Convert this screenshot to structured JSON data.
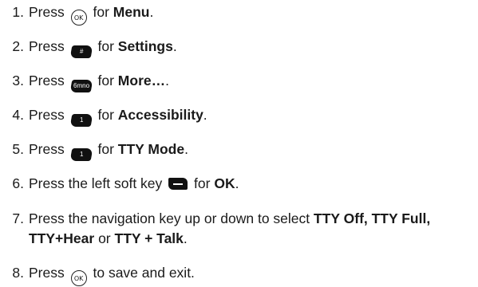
{
  "steps": [
    {
      "num": "1.",
      "pre": "Press",
      "key": "ok",
      "key_label": "OK",
      "mid": "for",
      "bold": "Menu",
      "post": "."
    },
    {
      "num": "2.",
      "pre": "Press",
      "key": "hash",
      "key_label": "#",
      "mid": "for",
      "bold": "Settings",
      "post": "."
    },
    {
      "num": "3.",
      "pre": "Press",
      "key": "six",
      "key_label": "6mno",
      "mid": "for",
      "bold": "More…",
      "post": "."
    },
    {
      "num": "4.",
      "pre": "Press",
      "key": "one",
      "key_label": "1",
      "mid": "for",
      "bold": "Accessibility",
      "post": "."
    },
    {
      "num": "5.",
      "pre": "Press",
      "key": "one",
      "key_label": "1",
      "mid": "for",
      "bold": "TTY Mode",
      "post": "."
    },
    {
      "num": "6.",
      "pre": "Press the left soft key",
      "key": "soft-left",
      "mid": "for",
      "bold": "OK",
      "post": "."
    },
    {
      "num": "7.",
      "text_a": "Press the navigation key up or down to select",
      "bold_a": "TTY Off, TTY Full, TTY+Hear",
      "text_b": "or",
      "bold_b": "TTY + Talk",
      "post": "."
    },
    {
      "num": "8.",
      "pre": "Press",
      "key": "ok",
      "key_label": "OK",
      "post": "to save and exit."
    }
  ]
}
